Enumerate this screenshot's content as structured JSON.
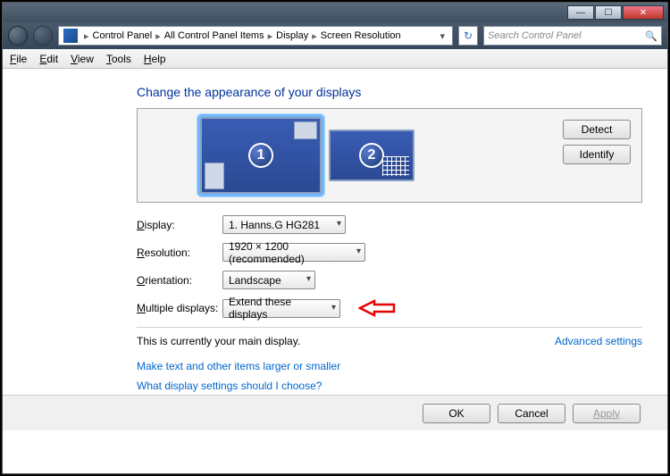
{
  "titlebar": {
    "min": "—",
    "max": "☐",
    "close": "✕"
  },
  "nav": {
    "breadcrumbs": [
      "Control Panel",
      "All Control Panel Items",
      "Display",
      "Screen Resolution"
    ],
    "search_placeholder": "Search Control Panel"
  },
  "menu": {
    "file": "File",
    "edit": "Edit",
    "view": "View",
    "tools": "Tools",
    "help": "Help"
  },
  "heading": "Change the appearance of your displays",
  "preview": {
    "monitors": [
      {
        "num": "1",
        "selected": true
      },
      {
        "num": "2",
        "selected": false
      }
    ],
    "detect": "Detect",
    "identify": "Identify"
  },
  "form": {
    "display_label": "Display:",
    "display_value": "1. Hanns.G HG281",
    "resolution_label": "Resolution:",
    "resolution_value": "1920 × 1200 (recommended)",
    "orientation_label": "Orientation:",
    "orientation_value": "Landscape",
    "multiple_label": "Multiple displays:",
    "multiple_value": "Extend these displays"
  },
  "status": "This is currently your main display.",
  "advanced": "Advanced settings",
  "links": {
    "larger": "Make text and other items larger or smaller",
    "which": "What display settings should I choose?"
  },
  "buttons": {
    "ok": "OK",
    "cancel": "Cancel",
    "apply": "Apply"
  }
}
